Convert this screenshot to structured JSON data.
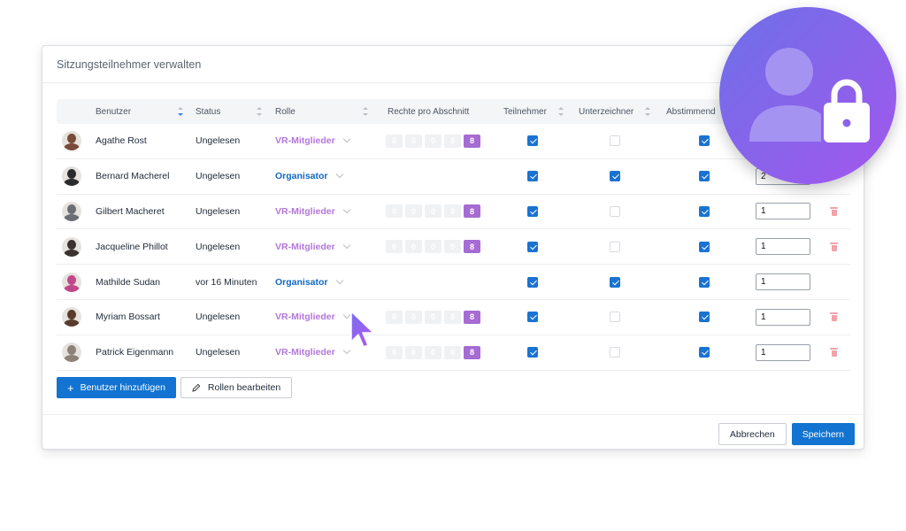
{
  "dialog": {
    "title": "Sitzungsteilnehmer verwalten"
  },
  "table": {
    "headers": {
      "user": "Benutzer",
      "status": "Status",
      "role": "Rolle",
      "rights": "Rechte pro Abschnitt",
      "participant": "Teilnehmer",
      "signer": "Unterzeichner",
      "voting": "Abstimmend"
    },
    "rows": [
      {
        "name": "Agathe Rost",
        "status": "Ungelesen",
        "role": "VR-Mitglieder",
        "role_type": "member",
        "rights": [
          "0",
          "0",
          "0",
          "0",
          "8"
        ],
        "participant": true,
        "signer": false,
        "voting": true,
        "order": "",
        "deletable": false,
        "avatar": "#7a4a3a"
      },
      {
        "name": "Bernard Macherel",
        "status": "Ungelesen",
        "role": "Organisator",
        "role_type": "organizer",
        "rights": [],
        "participant": true,
        "signer": true,
        "voting": true,
        "order": "2",
        "deletable": false,
        "avatar": "#2b2b2b"
      },
      {
        "name": "Gilbert Macheret",
        "status": "Ungelesen",
        "role": "VR-Mitglieder",
        "role_type": "member",
        "rights": [
          "0",
          "0",
          "0",
          "0",
          "8"
        ],
        "participant": true,
        "signer": false,
        "voting": true,
        "order": "1",
        "deletable": true,
        "avatar": "#6b6f75"
      },
      {
        "name": "Jacqueline Phillot",
        "status": "Ungelesen",
        "role": "VR-Mitglieder",
        "role_type": "member",
        "rights": [
          "0",
          "0",
          "0",
          "0",
          "8"
        ],
        "participant": true,
        "signer": false,
        "voting": true,
        "order": "1",
        "deletable": true,
        "avatar": "#3a3330"
      },
      {
        "name": "Mathilde Sudan",
        "status": "vor 16 Minuten",
        "role": "Organisator",
        "role_type": "organizer",
        "rights": [],
        "participant": true,
        "signer": true,
        "voting": true,
        "order": "1",
        "deletable": false,
        "avatar": "#c2478a"
      },
      {
        "name": "Myriam Bossart",
        "status": "Ungelesen",
        "role": "VR-Mitglieder",
        "role_type": "member",
        "rights": [
          "0",
          "0",
          "0",
          "0",
          "8"
        ],
        "participant": true,
        "signer": false,
        "voting": true,
        "order": "1",
        "deletable": true,
        "avatar": "#5a3b2e"
      },
      {
        "name": "Patrick Eigenmann",
        "status": "Ungelesen",
        "role": "VR-Mitglieder",
        "role_type": "member",
        "rights": [
          "0",
          "0",
          "0",
          "0",
          "8"
        ],
        "participant": true,
        "signer": false,
        "voting": true,
        "order": "1",
        "deletable": true,
        "avatar": "#8c8278"
      }
    ]
  },
  "actions": {
    "add_user": "Benutzer hinzufügen",
    "edit_roles": "Rollen bearbeiten",
    "add_icon": "plus-icon",
    "edit_icon": "pencil-icon"
  },
  "footer": {
    "cancel": "Abbrechen",
    "save": "Speichern"
  },
  "badge": {
    "icon": "user-lock-icon"
  },
  "colors": {
    "primary": "#1273d1",
    "member_role": "#b277d8",
    "organizer_role": "#1268c4",
    "delete": "#f0a3a8",
    "badge_gradient": [
      "#6d70e8",
      "#a455ee"
    ]
  }
}
